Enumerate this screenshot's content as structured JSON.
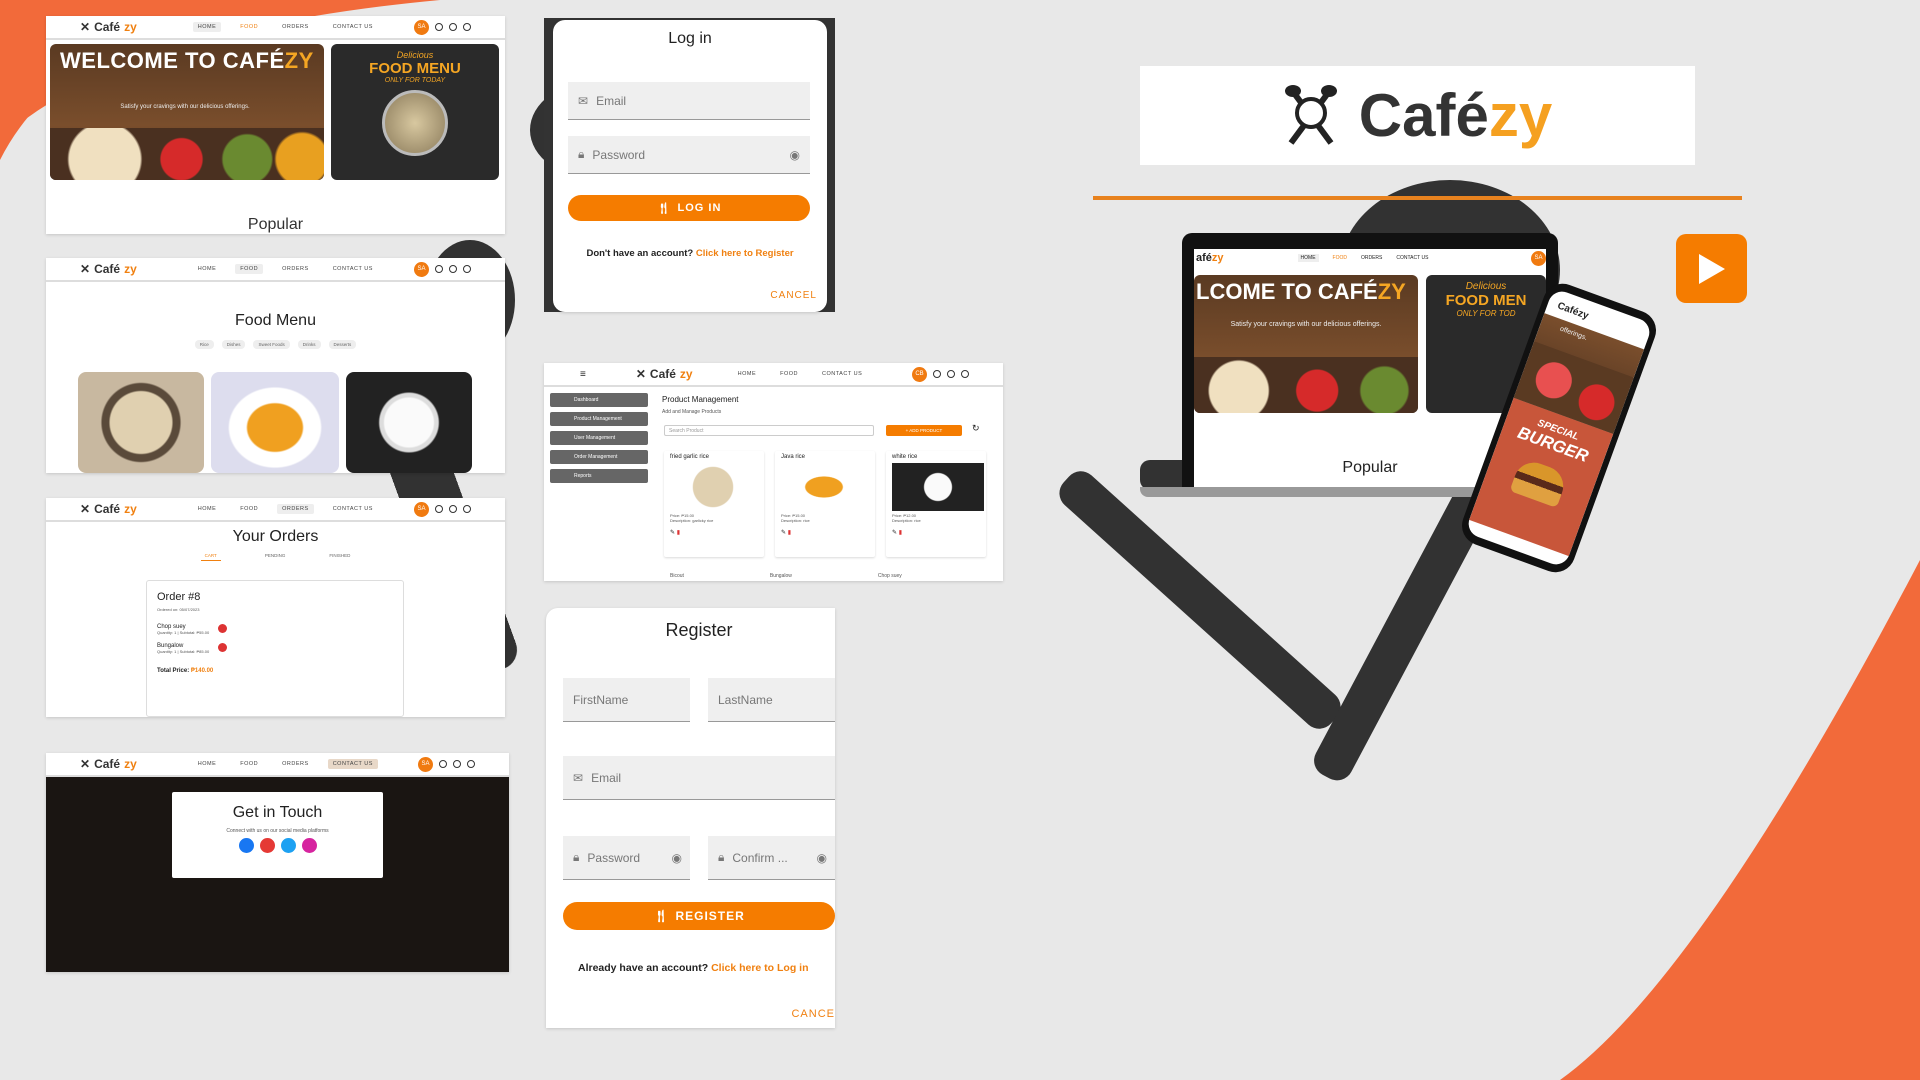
{
  "colors": {
    "accent": "#f57c00",
    "bg": "#e8e8e8",
    "orange_shape": "#f26a3a"
  },
  "home": {
    "logo_text": "Café",
    "logo_accent": "zy",
    "nav": [
      "HOME",
      "FOOD",
      "ORDERS",
      "CONTACT US"
    ],
    "avatar": "SA",
    "hero_title": "WELCOME TO CAFÉ",
    "hero_title_accent": "ZY",
    "hero_sub": "Satisfy your cravings with our delicious offerings.",
    "promo_line1": "Delicious",
    "promo_line2": "FOOD MENU",
    "promo_line3": "ONLY FOR TODAY",
    "section": "Popular"
  },
  "food": {
    "title": "Food Menu",
    "chips": [
      "Rice",
      "Dishes",
      "Sweet Foods",
      "Drinks",
      "Desserts"
    ]
  },
  "orders": {
    "title": "Your Orders",
    "tabs": [
      "CART",
      "PENDING",
      "FINISHED"
    ],
    "order_title": "Order #8",
    "order_date": "Ordered on: 05/07/2023",
    "items": [
      {
        "name": "Chop suey",
        "detail": "Quantity: 1 | Subtotal: ₱55.00"
      },
      {
        "name": "Bungalow",
        "detail": "Quantity: 1 | Subtotal: ₱85.00"
      }
    ],
    "total_label": "Total Price:",
    "total_value": "₱140.00"
  },
  "contact": {
    "title": "Get in Touch",
    "sub": "Connect with us on our social media platforms"
  },
  "login": {
    "title": "Log in",
    "email": "Email",
    "password": "Password",
    "button": "LOG IN",
    "no_account": "Don't have an account?",
    "register_link": "Click here to Register",
    "cancel": "CANCEL"
  },
  "admin": {
    "avatar": "CB",
    "nav": [
      "HOME",
      "FOOD",
      "CONTACT US"
    ],
    "sidebar": [
      "Dashboard",
      "Product Management",
      "User Management",
      "Order Management",
      "Reports"
    ],
    "heading": "Product Management",
    "sub": "Add and Manage Products",
    "search_placeholder": "Search Product",
    "add_button": "+ ADD PRODUCT",
    "products": [
      {
        "name": "fried garlic rice",
        "price": "Price: ₱15.00",
        "desc": "Description: garlicky rice"
      },
      {
        "name": "Java rice",
        "price": "Price: ₱15.00",
        "desc": "Description: rice"
      },
      {
        "name": "white rice",
        "price": "Price: ₱12.00",
        "desc": "Description: rice"
      }
    ],
    "more": [
      "Bicout",
      "Bungalow",
      "Chop suey"
    ]
  },
  "register": {
    "title": "Register",
    "first": "FirstName",
    "last": "LastName",
    "email": "Email",
    "password": "Password",
    "confirm": "Confirm ...",
    "button": "REGISTER",
    "have_account": "Already have an account?",
    "login_link": "Click here to Log in",
    "cancel": "CANCE"
  },
  "brand": {
    "name": "Café",
    "accent": "zy"
  },
  "device": {
    "hero_title": "LCOME TO CAFÉ",
    "hero_accent": "ZY",
    "hero_sub": "Satisfy your cravings with our delicious offerings.",
    "promo1": "Delicious",
    "promo2": "FOOD MEN",
    "promo3": "ONLY FOR TOD",
    "section": "Popular",
    "phone_logo": "Cafézy",
    "phone_text": "offerings.",
    "special1": "SPECIAL",
    "special2": "BURGER"
  }
}
